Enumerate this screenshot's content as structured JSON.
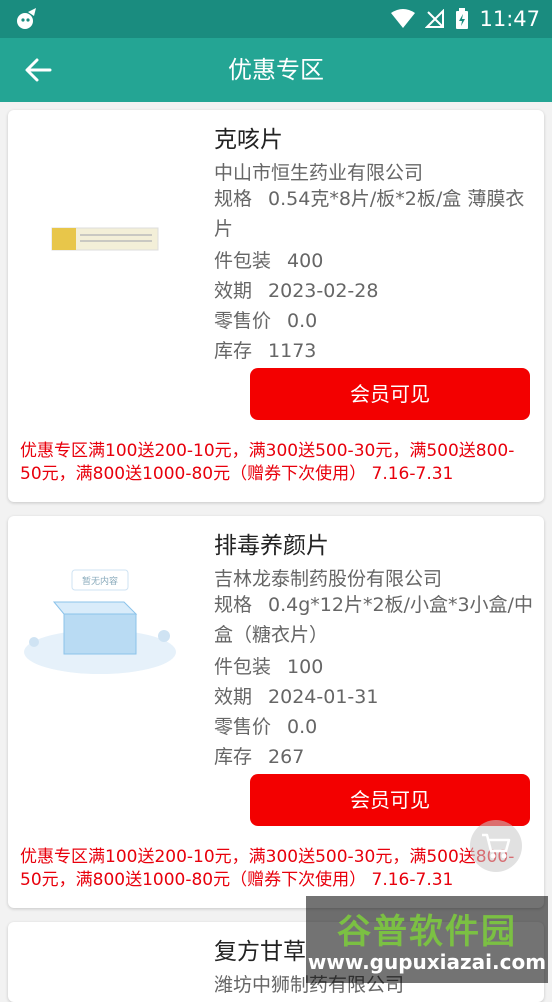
{
  "status_bar": {
    "time": "11:47"
  },
  "header": {
    "title": "优惠专区"
  },
  "products": [
    {
      "name": "克咳片",
      "company": "中山市恒生药业有限公司",
      "spec_label": "规格",
      "spec_value": "0.54克*8片/板*2板/盒 薄膜衣片",
      "pack_label": "件包装",
      "pack_value": "400",
      "expiry_label": "效期",
      "expiry_value": "2023-02-28",
      "price_label": "零售价",
      "price_value": "0.0",
      "stock_label": "库存",
      "stock_value": "1173",
      "button_label": "会员可见",
      "promo": "优惠专区满100送200-10元，满300送500-30元，满500送800-50元，满800送1000-80元（赠券下次使用） 7.16-7.31"
    },
    {
      "name": "排毒养颜片",
      "company": "吉林龙泰制药股份有限公司",
      "spec_label": "规格",
      "spec_value": "0.4g*12片*2板/小盒*3小盒/中盒（糖衣片）",
      "pack_label": "件包装",
      "pack_value": "100",
      "expiry_label": "效期",
      "expiry_value": "2024-01-31",
      "price_label": "零售价",
      "price_value": "0.0",
      "stock_label": "库存",
      "stock_value": "267",
      "button_label": "会员可见",
      "promo": "优惠专区满100送200-10元，满300送500-30元，满500送800-50元，满800送1000-80元（赠券下次使用） 7.16-7.31",
      "placeholder_text": "暂无内容"
    },
    {
      "name": "复方甘草",
      "company": "潍坊中狮制药有限公司"
    }
  ],
  "watermark": {
    "title": "谷普软件园",
    "url": "www.gupuxiazai.com"
  },
  "colors": {
    "status_bar": "#1a8c7f",
    "app_bar": "#24a594",
    "button": "#f30000",
    "promo": "#e8000c"
  }
}
